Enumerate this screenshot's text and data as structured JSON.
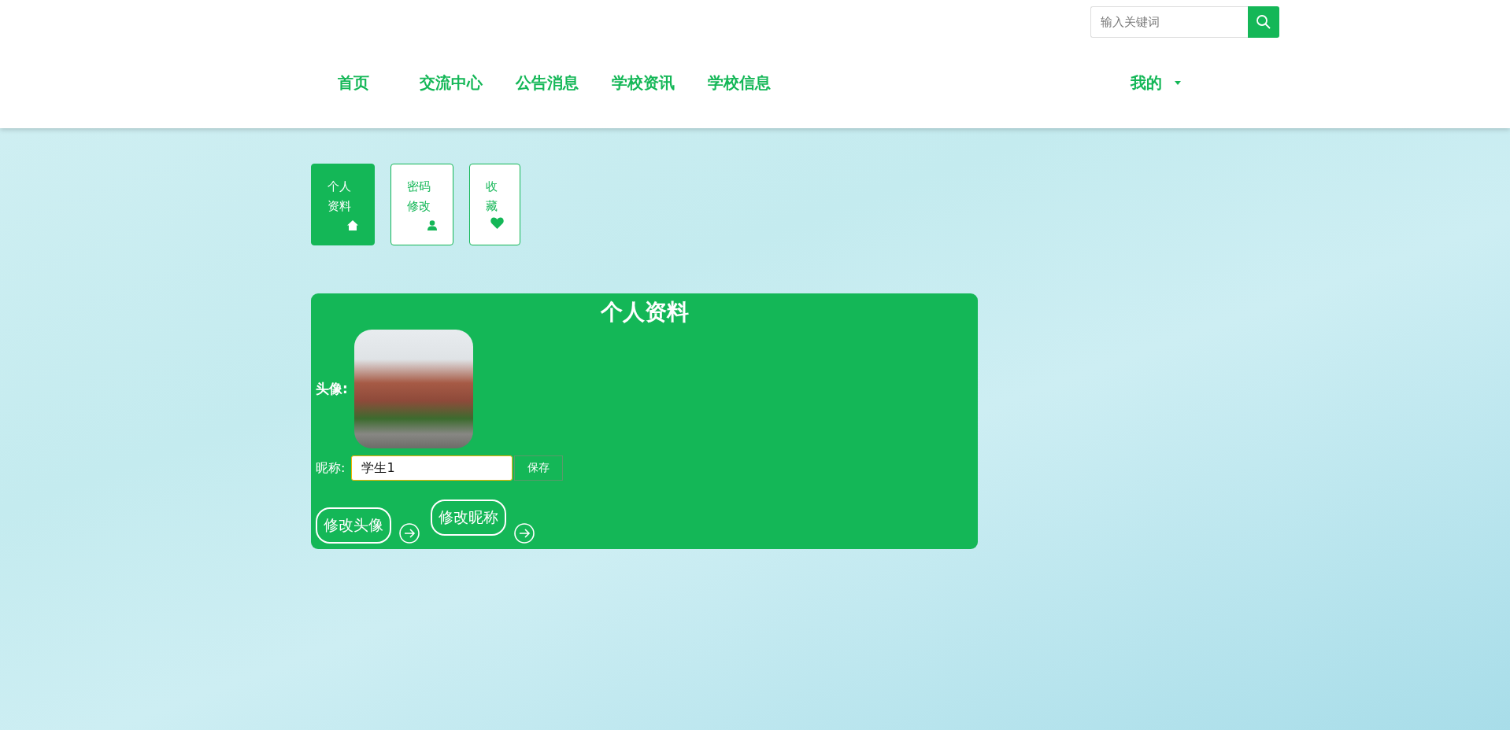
{
  "search": {
    "placeholder": "输入关键词"
  },
  "nav": {
    "items": [
      {
        "label": "首页"
      },
      {
        "label": "交流中心"
      },
      {
        "label": "公告消息"
      },
      {
        "label": "学校资讯"
      },
      {
        "label": "学校信息"
      }
    ],
    "user_menu": {
      "label": "我的"
    }
  },
  "tabs": [
    {
      "label": "个人资料",
      "selected": true
    },
    {
      "label": "密码修改",
      "selected": false
    },
    {
      "label": "收藏",
      "selected": false
    }
  ],
  "profile": {
    "title": "个人资料",
    "avatar_label": "头像:",
    "nickname_label": "昵称:",
    "nickname": "学生1",
    "save": "保存",
    "actions": [
      {
        "label": "修改头像"
      },
      {
        "label": "修改昵称"
      }
    ]
  }
}
